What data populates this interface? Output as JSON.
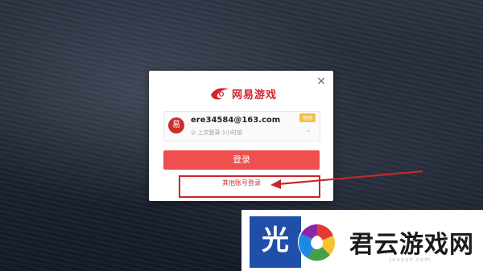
{
  "dialog": {
    "close_symbol": "×",
    "brand_text": "网易游戏",
    "account": {
      "avatar_text": "易",
      "email": "ere34584@163.com",
      "last_login": "◎ 上次登录:1小时前",
      "badge": "常用",
      "chevron": "⌄"
    },
    "login_button": "登录",
    "other_login": "其他账号登录"
  },
  "watermark": {
    "blue_text": "光",
    "title": "君云游戏网",
    "subtitle": "junyun.com"
  },
  "colors": {
    "brand_red": "#d8212a",
    "button_red": "#ef4f4f",
    "annotation_red": "#c62828",
    "badge_yellow": "#f3c044"
  }
}
